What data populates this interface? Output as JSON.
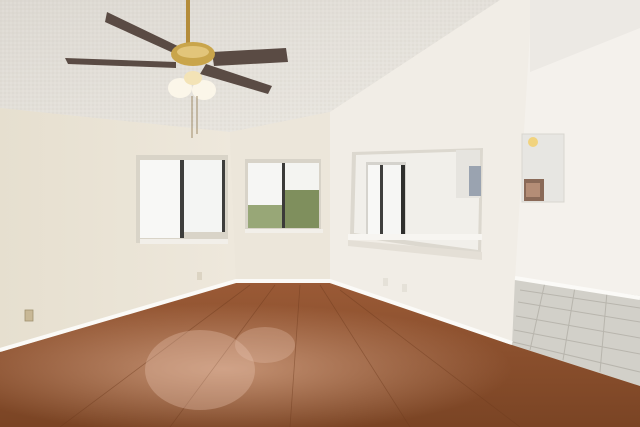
{
  "scene": {
    "kind": "photo",
    "subject": "empty-room-interior",
    "elements": [
      "textured-ceiling",
      "ceiling-fan-with-light",
      "left-window",
      "center-window",
      "interior-pass-through-opening",
      "laminate-wood-floor",
      "tile-floor",
      "baseboards",
      "electrical-outlets"
    ]
  },
  "colors": {
    "ceiling": "#e4e0d9",
    "wall_left": "#ece5d7",
    "wall_center": "#eee8dc",
    "wall_right": "#f3efe8",
    "floor": "#8a4f2c",
    "floor_highlight": "#b9785a",
    "tile": "#cfcdc6",
    "baseboard": "#f7f5f1",
    "window_glass": "#f6f7f6",
    "fan_blade": "#5a4b44",
    "fan_brass": "#c9a54b"
  }
}
